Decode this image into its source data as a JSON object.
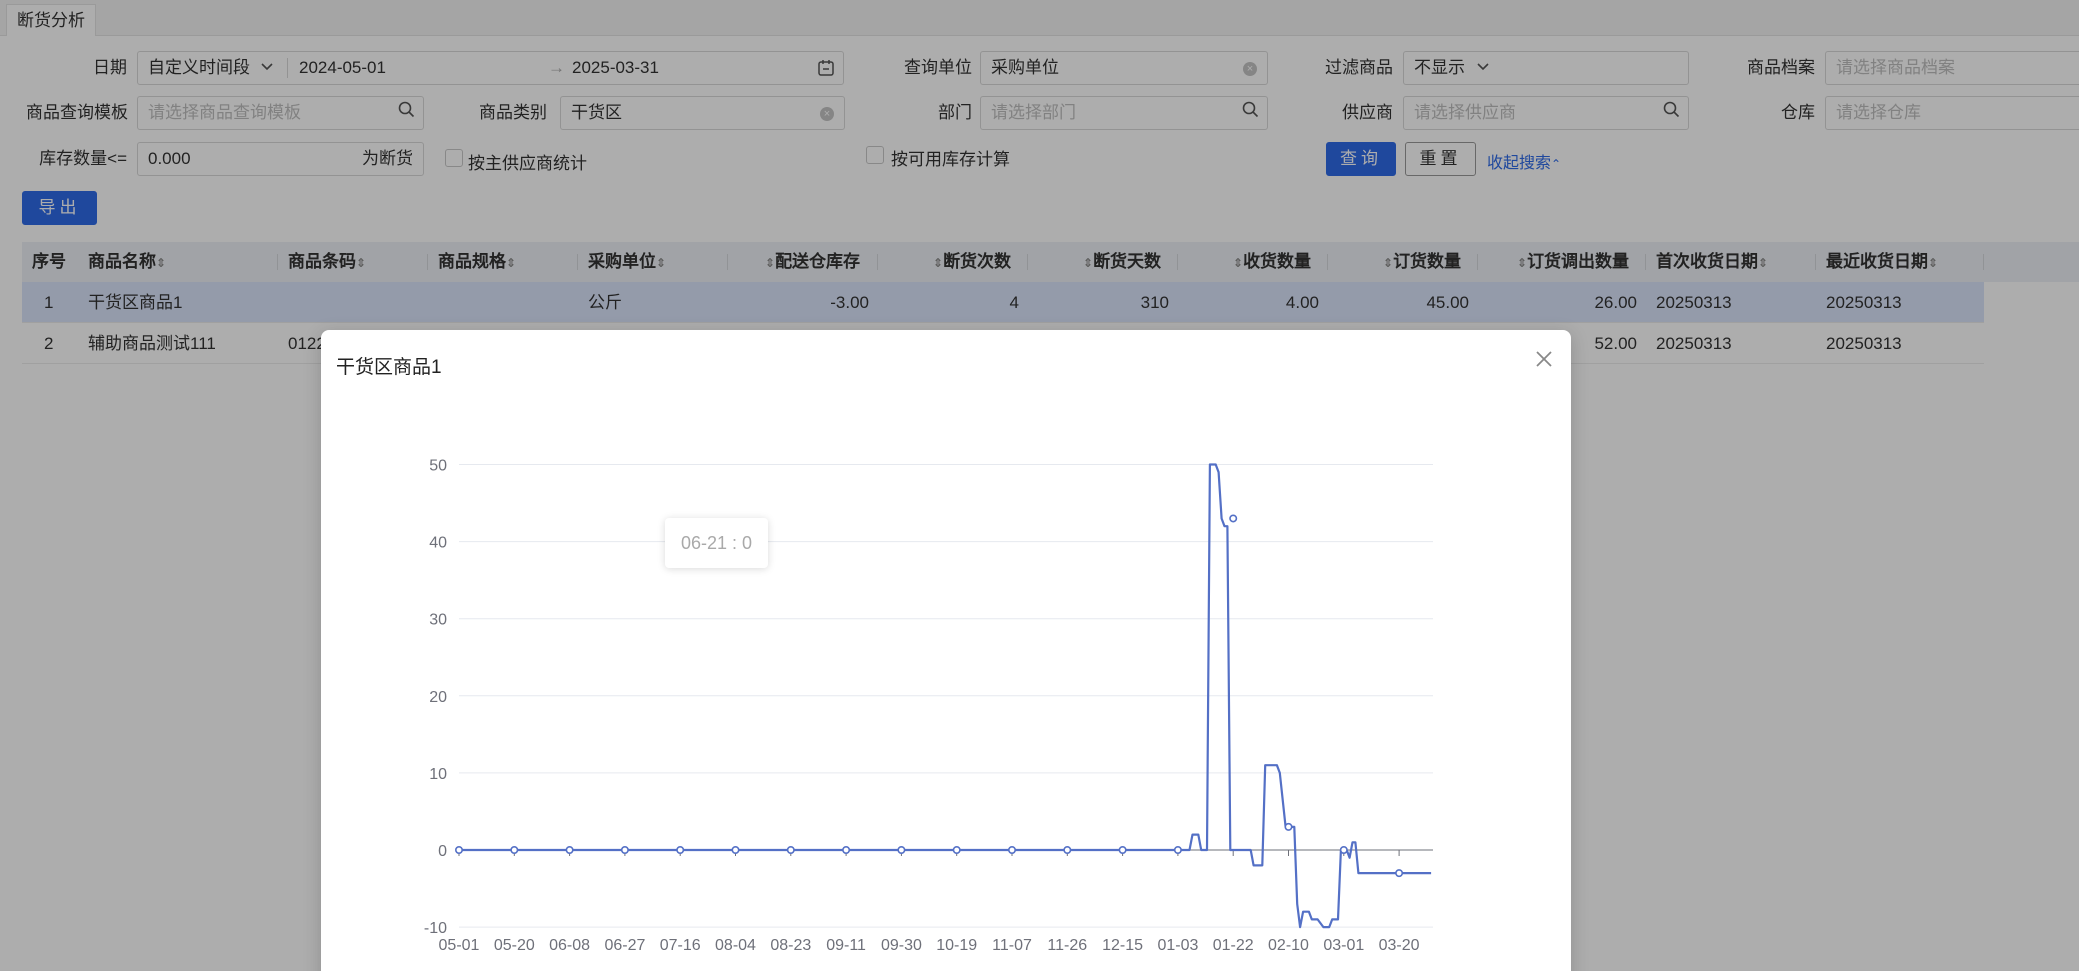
{
  "tab": {
    "label": "断货分析"
  },
  "filters": {
    "date_label": "日期",
    "date_mode": "自定义时间段",
    "date_start": "2024-05-01",
    "date_arrow": "→",
    "date_end": "2025-03-31",
    "unit_label": "查询单位",
    "unit_value": "采购单位",
    "filter_label": "过滤商品",
    "filter_value": "不显示",
    "archive_label": "商品档案",
    "archive_placeholder": "请选择商品档案",
    "template_label": "商品查询模板",
    "template_placeholder": "请选择商品查询模板",
    "category_label": "商品类别",
    "category_value": "干货区",
    "dept_label": "部门",
    "dept_placeholder": "请选择部门",
    "supplier_label": "供应商",
    "supplier_placeholder": "请选择供应商",
    "warehouse_label": "仓库",
    "warehouse_placeholder": "请选择仓库",
    "stock_label": "库存数量<=",
    "stock_value": "0.000",
    "stock_suffix": "为断货",
    "main_supplier_label": "按主供应商统计",
    "available_stock_label": "按可用库存计算",
    "query_button": "查询",
    "reset_button": "重置",
    "collapse_link": "收起搜索"
  },
  "export_button": "导出",
  "table": {
    "headers": [
      "序号",
      "商品名称",
      "商品条码",
      "商品规格",
      "采购单位",
      "配送仓库存",
      "断货次数",
      "断货天数",
      "收货数量",
      "订货数量",
      "订货调出数量",
      "首次收货日期",
      "最近收货日期"
    ],
    "rows": [
      {
        "index": "1",
        "name": "干货区商品1",
        "barcode": "",
        "spec": "",
        "unit": "公斤",
        "stock": "-3.00",
        "count": "4",
        "days": "310",
        "received": "4.00",
        "ordered": "45.00",
        "out": "26.00",
        "first": "20250313",
        "last": "20250313"
      },
      {
        "index": "2",
        "name": "辅助商品测试111",
        "barcode": "0122",
        "spec": "",
        "unit": "",
        "stock": "",
        "count": "",
        "days": "",
        "received": "",
        "ordered": "",
        "out": "52.00",
        "first": "20250313",
        "last": "20250313"
      }
    ]
  },
  "modal": {
    "title": "干货区商品1",
    "tooltip": "06-21 : 0"
  },
  "colors": {
    "primary": "#2f6be8",
    "line": "#5470c6",
    "selected_row": "#dbe5fb"
  },
  "chart_data": {
    "type": "line",
    "title": "",
    "xlabel": "",
    "ylabel": "",
    "ylim": [
      -10,
      50
    ],
    "yticks": [
      -10,
      0,
      10,
      20,
      30,
      40,
      50
    ],
    "xtick_labels": [
      "05-01",
      "05-20",
      "06-08",
      "06-27",
      "07-16",
      "08-04",
      "08-23",
      "09-11",
      "09-30",
      "10-19",
      "11-07",
      "11-26",
      "12-15",
      "01-03",
      "01-22",
      "02-10",
      "03-01",
      "03-20"
    ],
    "grid": true,
    "series": [
      {
        "points": [
          [
            "05-01",
            0
          ],
          [
            "01-03",
            0
          ],
          [
            "01-07",
            0
          ],
          [
            "01-08",
            2
          ],
          [
            "01-10",
            2
          ],
          [
            "01-11",
            0
          ],
          [
            "01-13",
            0
          ],
          [
            "01-14",
            50
          ],
          [
            "01-16",
            50
          ],
          [
            "01-17",
            49
          ],
          [
            "01-18",
            43
          ],
          [
            "01-19",
            42
          ],
          [
            "01-20",
            42
          ],
          [
            "01-21",
            0
          ],
          [
            "01-28",
            0
          ],
          [
            "01-29",
            -2
          ],
          [
            "02-01",
            -2
          ],
          [
            "02-02",
            11
          ],
          [
            "02-04",
            11
          ],
          [
            "02-06",
            11
          ],
          [
            "02-07",
            10
          ],
          [
            "02-09",
            3
          ],
          [
            "02-12",
            3
          ],
          [
            "02-13",
            -7
          ],
          [
            "02-14",
            -10
          ],
          [
            "02-15",
            -8
          ],
          [
            "02-17",
            -8
          ],
          [
            "02-18",
            -9
          ],
          [
            "02-20",
            -9
          ],
          [
            "02-22",
            -10
          ],
          [
            "02-24",
            -10
          ],
          [
            "02-25",
            -9
          ],
          [
            "02-27",
            -9
          ],
          [
            "02-28",
            0
          ],
          [
            "03-02",
            0
          ],
          [
            "03-03",
            -1
          ],
          [
            "03-04",
            1
          ],
          [
            "03-05",
            1
          ],
          [
            "03-06",
            -3
          ],
          [
            "03-20",
            -3
          ],
          [
            "03-31",
            -3
          ]
        ]
      }
    ]
  }
}
